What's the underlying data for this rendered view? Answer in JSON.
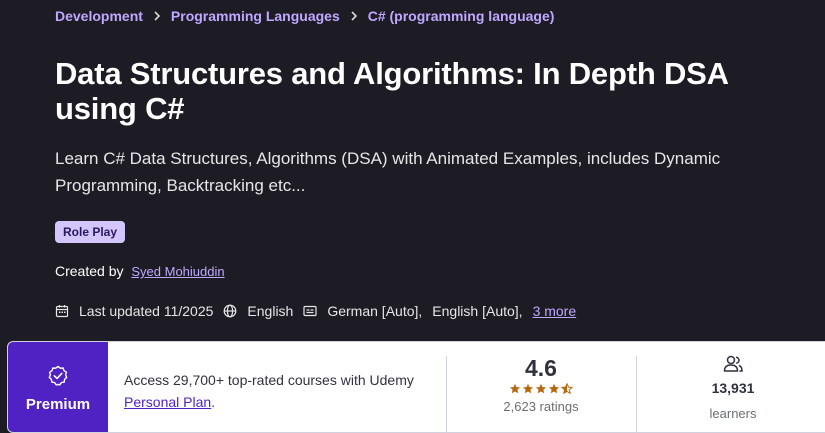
{
  "breadcrumb": {
    "items": [
      "Development",
      "Programming Languages",
      "C# (programming language)"
    ]
  },
  "course": {
    "title": "Data Structures and Algorithms: In Depth DSA using C#",
    "subtitle": "Learn C# Data Structures, Algorithms (DSA) with Animated Examples, includes Dynamic Programming, Backtracking etc...",
    "badge": "Role Play",
    "created_by_label": "Created by",
    "instructor": "Syed Mohiuddin",
    "last_updated": "Last updated 11/2025",
    "language": "English",
    "captions": [
      "German [Auto],",
      "English [Auto],"
    ],
    "captions_more": "3 more"
  },
  "card": {
    "premium_label": "Premium",
    "access_text": "Access 29,700+ top-rated courses with Udemy",
    "plan_link": "Personal Plan",
    "plan_suffix": ".",
    "rating": "4.6",
    "rating_stars": 4.5,
    "ratings_count": "2,623 ratings",
    "learners_count": "13,931",
    "learners_label": "learners"
  },
  "colors": {
    "background": "#1d1c24",
    "link": "#c0a7ff",
    "premium": "#5022c3",
    "star": "#b4690e",
    "badge_bg": "#d2c6fb"
  },
  "icons": {
    "breadcrumb_separator": "chevron-right-icon",
    "last_updated": "calendar-icon",
    "language": "globe-icon",
    "captions": "closed-captions-icon",
    "premium": "badge-check-icon",
    "learners": "users-icon"
  }
}
